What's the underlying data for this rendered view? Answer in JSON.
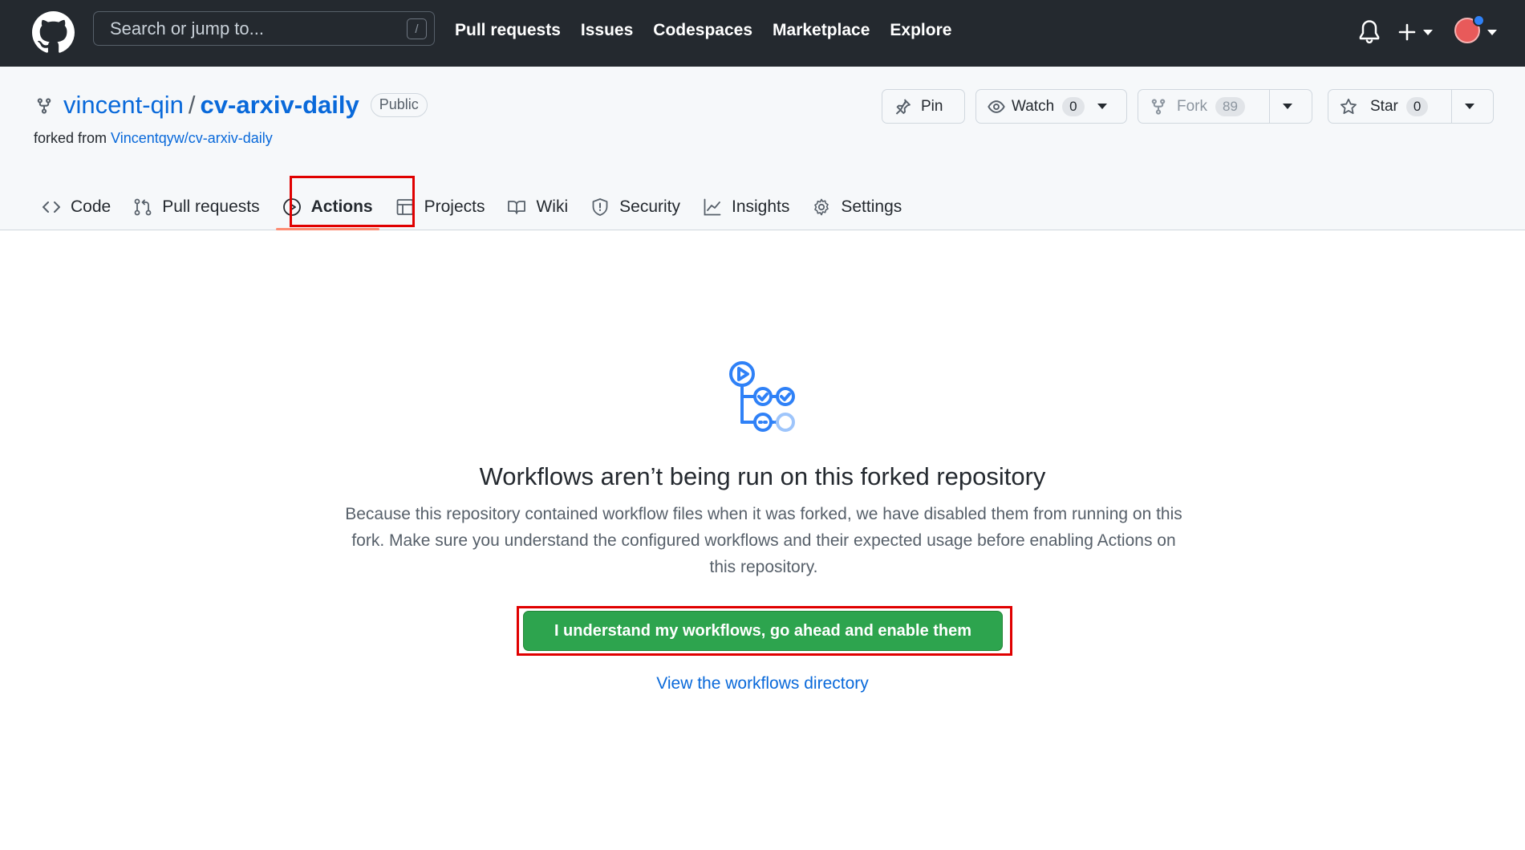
{
  "header": {
    "search_placeholder": "Search or jump to...",
    "search_shortcut": "/",
    "nav": [
      "Pull requests",
      "Issues",
      "Codespaces",
      "Marketplace",
      "Explore"
    ]
  },
  "repo": {
    "owner": "vincent-qin",
    "separator": "/",
    "name": "cv-arxiv-daily",
    "visibility": "Public",
    "forked_from_prefix": "forked from",
    "forked_from": "Vincentqyw/cv-arxiv-daily",
    "buttons": {
      "pin": "Pin",
      "watch": "Watch",
      "watch_count": "0",
      "fork": "Fork",
      "fork_count": "89",
      "star": "Star",
      "star_count": "0"
    },
    "tabs": [
      {
        "label": "Code",
        "icon": "code-icon"
      },
      {
        "label": "Pull requests",
        "icon": "git-pull-request-icon"
      },
      {
        "label": "Actions",
        "icon": "play-icon",
        "active": true
      },
      {
        "label": "Projects",
        "icon": "table-icon"
      },
      {
        "label": "Wiki",
        "icon": "book-icon"
      },
      {
        "label": "Security",
        "icon": "shield-icon"
      },
      {
        "label": "Insights",
        "icon": "graph-icon"
      },
      {
        "label": "Settings",
        "icon": "gear-icon"
      }
    ]
  },
  "blankslate": {
    "title": "Workflows aren’t being run on this forked repository",
    "text": "Because this repository contained workflow files when it was forked, we have disabled them from running on this fork. Make sure you understand the configured workflows and their expected usage before enabling Actions on this repository.",
    "enable_button": "I understand my workflows, go ahead and enable them",
    "view_link": "View the workflows directory"
  },
  "colors": {
    "header_bg": "#24292f",
    "link": "#0969da",
    "primary_button": "#2da44e",
    "highlight": "#e00000",
    "active_tab_underline": "#fd8c73"
  }
}
